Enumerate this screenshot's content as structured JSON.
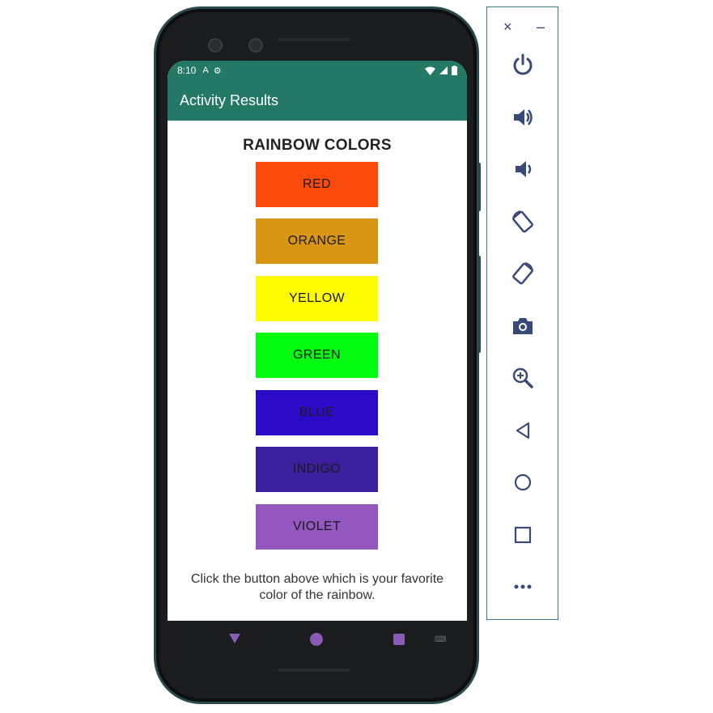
{
  "statusbar": {
    "time": "8:10",
    "icon_a": "A",
    "icon_gear": "⚙"
  },
  "appbar": {
    "title": "Activity Results"
  },
  "content": {
    "heading": "RAINBOW COLORS",
    "buttons": [
      {
        "label": "RED",
        "color": "#fb4b0c"
      },
      {
        "label": "ORANGE",
        "color": "#d99514"
      },
      {
        "label": "YELLOW",
        "color": "#fefc00"
      },
      {
        "label": "GREEN",
        "color": "#02fb0e"
      },
      {
        "label": "BLUE",
        "color": "#2c0bc8"
      },
      {
        "label": "INDIGO",
        "color": "#3b1f9c"
      },
      {
        "label": "VIOLET",
        "color": "#9456bf"
      }
    ],
    "hint": "Click the button above which is your favorite color of the rainbow."
  },
  "navbar": {
    "keyboard_icon": "⌨"
  },
  "toolbar": {
    "close_glyph": "×",
    "minimize_glyph": "–",
    "buttons": [
      {
        "icon": "power-icon"
      },
      {
        "icon": "volume-up-icon"
      },
      {
        "icon": "volume-down-icon"
      },
      {
        "icon": "rotate-left-icon"
      },
      {
        "icon": "rotate-right-icon"
      },
      {
        "icon": "camera-icon"
      },
      {
        "icon": "zoom-icon"
      },
      {
        "icon": "back-icon"
      },
      {
        "icon": "home-icon"
      },
      {
        "icon": "overview-icon"
      },
      {
        "icon": "more-icon"
      }
    ]
  },
  "colors": {
    "app_bar": "#247866",
    "toolbar_icon": "#3a4a78",
    "nav_accent": "#8a5bb5"
  }
}
